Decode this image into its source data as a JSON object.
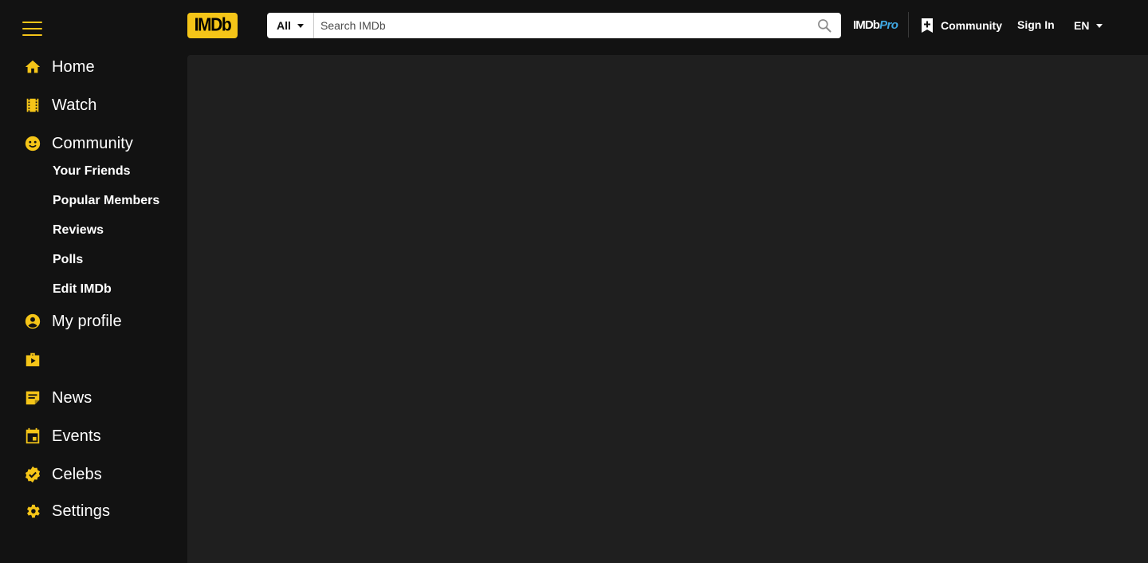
{
  "header": {
    "logo_text": "IMDb",
    "search": {
      "category": "All",
      "placeholder": "Search IMDb",
      "value": ""
    },
    "imdbpro": {
      "part1": "IMDb",
      "part2": "Pro"
    },
    "community_label": "Community",
    "signin_label": "Sign In",
    "language": "EN"
  },
  "sidebar": {
    "items": [
      {
        "label": "Home",
        "icon": "home-icon"
      },
      {
        "label": "Watch",
        "icon": "film-icon"
      },
      {
        "label": "Community",
        "icon": "community-icon"
      },
      {
        "label": "My profile",
        "icon": "profile-icon"
      },
      {
        "label": "",
        "icon": "video-briefcase-icon"
      },
      {
        "label": "News",
        "icon": "news-icon"
      },
      {
        "label": "Events",
        "icon": "calendar-icon"
      },
      {
        "label": "Celebs",
        "icon": "verified-badge-icon"
      },
      {
        "label": "Settings",
        "icon": "gear-icon"
      }
    ],
    "community_sub": [
      {
        "label": "Your Friends"
      },
      {
        "label": "Popular Members"
      },
      {
        "label": "Reviews"
      },
      {
        "label": "Polls"
      },
      {
        "label": "Edit IMDb"
      }
    ]
  },
  "colors": {
    "accent": "#f5c518",
    "background": "#121212",
    "main_background": "#1f1f1f",
    "pro_blue": "#3fa6e0"
  }
}
